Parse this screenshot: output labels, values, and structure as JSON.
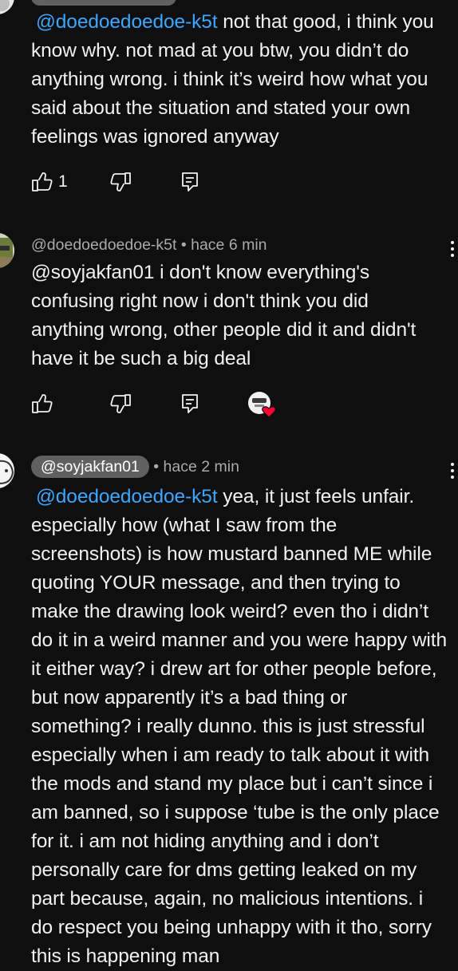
{
  "comments": [
    {
      "mention": "@doedoedoedoe-k5t",
      "body": "not that good, i think you know why. not mad at you btw, you didn’t do anything wrong. i think it’s weird how what you said about the situation and stated your own feelings was ignored anyway",
      "likes": "1"
    },
    {
      "author": "@doedoedoedoe-k5t",
      "time": "• hace 6 min",
      "body": "@soyjakfan01 i don't know everything's confusing right now i don't think you did anything wrong, other people did it and didn't have it be such a big deal"
    },
    {
      "author": "@soyjakfan01",
      "time": "• hace 2 min",
      "mention": "@doedoedoedoe-k5t",
      "body": "yea, it just feels unfair. especially how (what I saw from the screenshots) is how mustard banned ME while quoting YOUR message, and then trying to make the drawing look weird? even tho i didn’t do it in a weird manner and you were happy with it either way? i drew art for other people before, but now apparently it’s a bad thing or something? i really dunno. this is just stressful especially when i am ready to talk about it with the mods and stand my place but i can’t since i am banned, so i suppose ‘tube is the only place for it. i am not hiding anything and i don’t personally care for dms getting leaked on my part because, again, no malicious intentions. i do respect you being unhappy with it tho, sorry this is happening man"
    }
  ],
  "icons": {
    "like": "thumbs-up-icon",
    "dislike": "thumbs-down-icon",
    "reply": "reply-icon",
    "heart": "creator-heart-icon",
    "more": "more-vertical-icon"
  },
  "colors": {
    "background": "#0f0f0f",
    "mention": "#3ea6ff",
    "meta": "#aaaaaa",
    "pill": "#606060",
    "heart": "#ff0033"
  }
}
